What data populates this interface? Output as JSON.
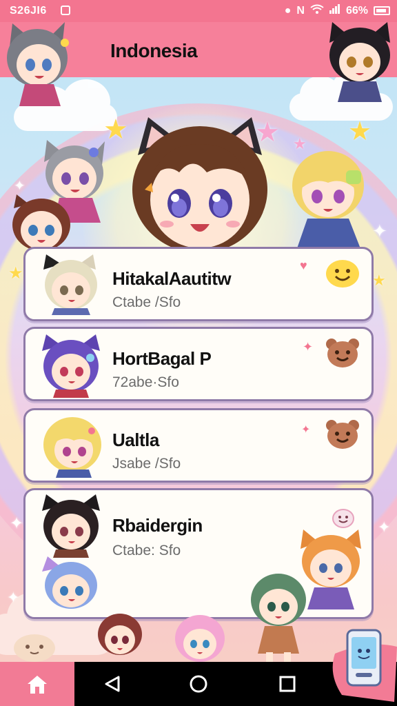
{
  "status_bar": {
    "time": "S26JI6",
    "battery": "66%",
    "icons": [
      "notification-icon",
      "mute-icon",
      "wifi-icon",
      "signal-icon",
      "battery-icon"
    ]
  },
  "header": {
    "title": "Indonesia"
  },
  "contacts": [
    {
      "name": "HitakalAautitw",
      "subtitle": "Ctabe /Sfo",
      "avatar": "cat-ear-blonde-girl-avatar"
    },
    {
      "name": "HortBagal P",
      "subtitle": "72abe·Sfo",
      "avatar": "purple-hair-girl-avatar"
    },
    {
      "name": "Ualtla",
      "subtitle": "Jsabe /Sfo",
      "avatar": "blonde-girl-avatar"
    },
    {
      "name": "Rbaidergin",
      "subtitle": "Ctabe: Sfo",
      "avatar": "dark-hair-cat-girl-avatar"
    }
  ],
  "navigation": {
    "home": "home-icon",
    "back": "back-triangle-icon",
    "home_circle": "home-circle-icon",
    "recents": "recents-square-icon"
  },
  "colors": {
    "status_bar": "#f37590",
    "header": "#f6809a",
    "card_border": "#8f7aa8",
    "home_tab": "#f27b95",
    "nav_bar": "#000000"
  }
}
